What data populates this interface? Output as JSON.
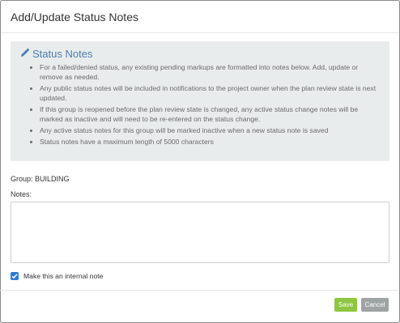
{
  "dialog": {
    "title": "Add/Update Status Notes"
  },
  "info": {
    "heading": "Status Notes",
    "icon": "pencil-icon",
    "accent_color": "#4a7db0",
    "items": [
      "For a failed/denied status, any existing pending markups are formatted into notes below. Add, update or remove as needed.",
      "Any public status notes will be included in notifications to the project owner when the plan review state is next updated.",
      "If this group is reopened before the plan review state is changed, any active status change notes will be marked as inactive and will need to be re-entered on the status change.",
      "Any active status notes for this group will be marked inactive when a new status note is saved",
      "Status notes have a maximum length of 5000 characters"
    ]
  },
  "form": {
    "group_label": "Group: BUILDING",
    "notes_label": "Notes:",
    "notes_value": "",
    "internal_note_label": "Make this an internal note",
    "internal_note_checked": true
  },
  "buttons": {
    "save": "Save",
    "cancel": "Cancel",
    "save_color": "#8dc63f",
    "cancel_color": "#9ea3a3"
  }
}
